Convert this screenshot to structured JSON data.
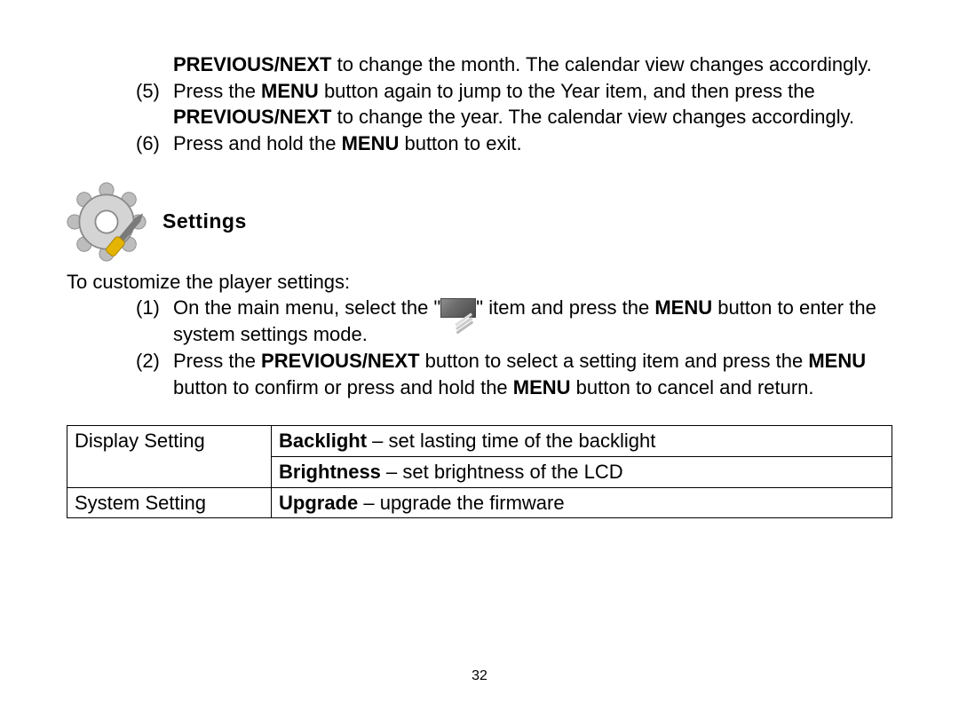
{
  "para0": {
    "bold": "PREVIOUS/NEXT",
    "rest": " to change the month. The calendar view changes accordingly."
  },
  "item5": {
    "num": "(5)",
    "a": "Press the ",
    "b1": "MENU",
    "c": " button again to jump to the Year item, and then press the ",
    "b2": "PREVIOUS/NEXT",
    "d": " to change the year. The calendar view changes accordingly."
  },
  "item6": {
    "num": "(6)",
    "a": "Press and hold the ",
    "b1": "MENU",
    "c": " button to exit."
  },
  "section_title": "Settings",
  "intro": "To customize the player settings:",
  "step1": {
    "num": "(1)",
    "a": "On the main menu, select the \"",
    "b": "\" item and press the ",
    "b1": "MENU",
    "c": " button to enter the system settings mode."
  },
  "step2": {
    "num": "(2)",
    "a": "Press the ",
    "b1": "PREVIOUS/NEXT",
    "c": " button to select a setting item and press the ",
    "b2": "MENU",
    "d": " button to confirm or press and hold the ",
    "b3": "MENU",
    "e": " button to cancel and return."
  },
  "table": {
    "r1c1": "Display Setting",
    "r1c2_b": "Backlight",
    "r1c2_t": " – set lasting time of the backlight",
    "r2c2_b": "Brightness",
    "r2c2_t": " – set brightness of the LCD",
    "r3c1": "System Setting",
    "r3c2_b": "Upgrade",
    "r3c2_t": " – upgrade the firmware"
  },
  "page_number": "32"
}
